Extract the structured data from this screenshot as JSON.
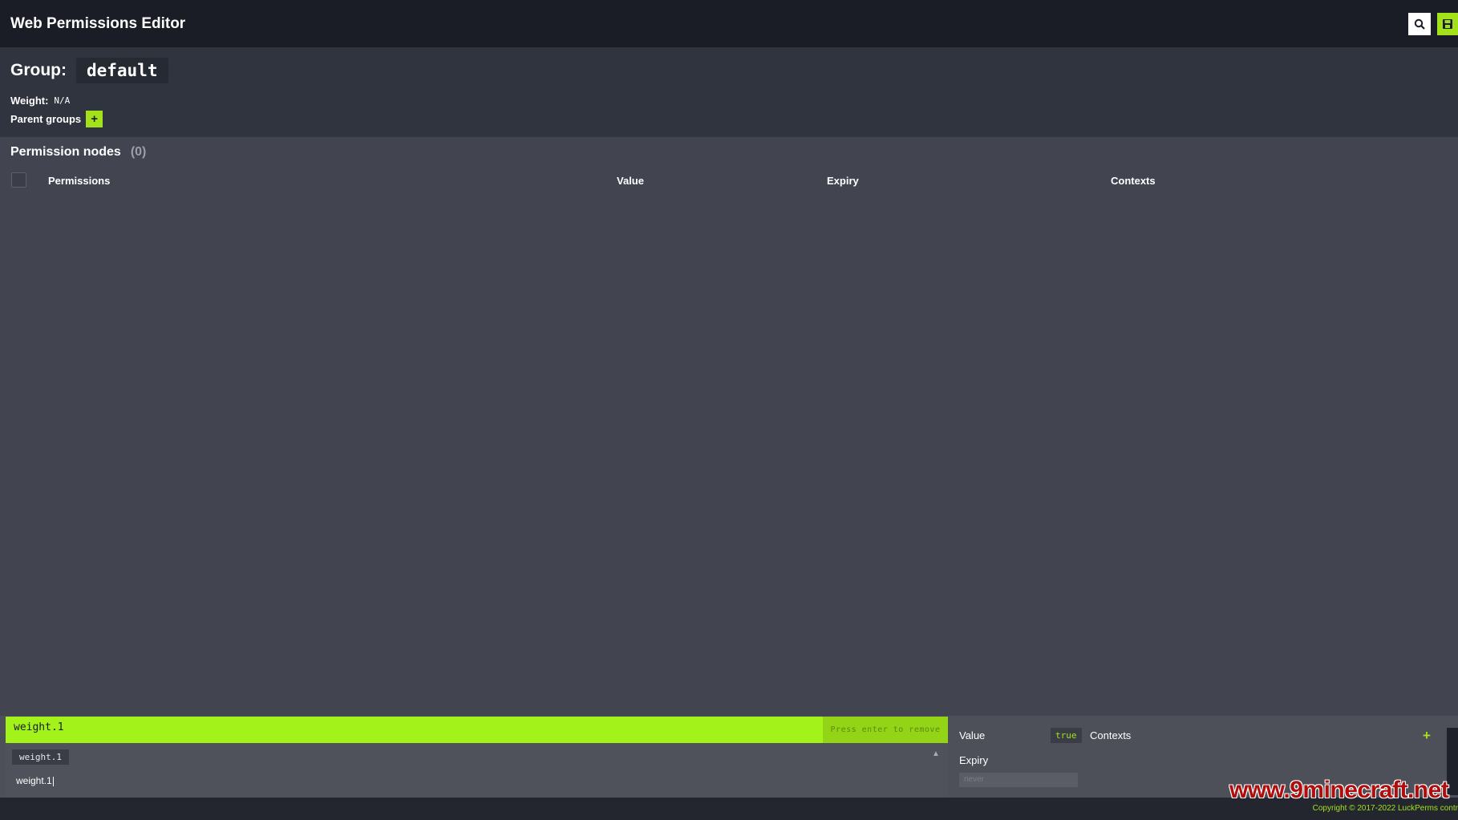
{
  "header": {
    "title": "Web Permissions Editor",
    "search_icon": "search-icon",
    "save_icon": "save-icon"
  },
  "group": {
    "label": "Group:",
    "name": "default",
    "weight_label": "Weight:",
    "weight_value": "N/A",
    "parent_groups_label": "Parent groups",
    "add_parent_label": "+"
  },
  "nodes": {
    "title": "Permission nodes",
    "count": "(0)",
    "columns": {
      "permissions": "Permissions",
      "value": "Value",
      "expiry": "Expiry",
      "contexts": "Contexts"
    }
  },
  "editor": {
    "node_input": "weight.1",
    "hint": "Press enter to remove",
    "suggestion": "weight.1",
    "suggestion_caret": "▲",
    "typed_value": "weight.1",
    "value_label": "Value",
    "value": "true",
    "contexts_label": "Contexts",
    "contexts_add": "+",
    "expiry_label": "Expiry",
    "expiry_placeholder": "never"
  },
  "footer": {
    "watermark": "www.9minecraft.net",
    "copyright": "Copyright © 2017-2022 LuckPerms contr"
  },
  "colors": {
    "accent": "#a3e21a",
    "header_bg": "#1a1d26",
    "page_bg": "#424550"
  }
}
